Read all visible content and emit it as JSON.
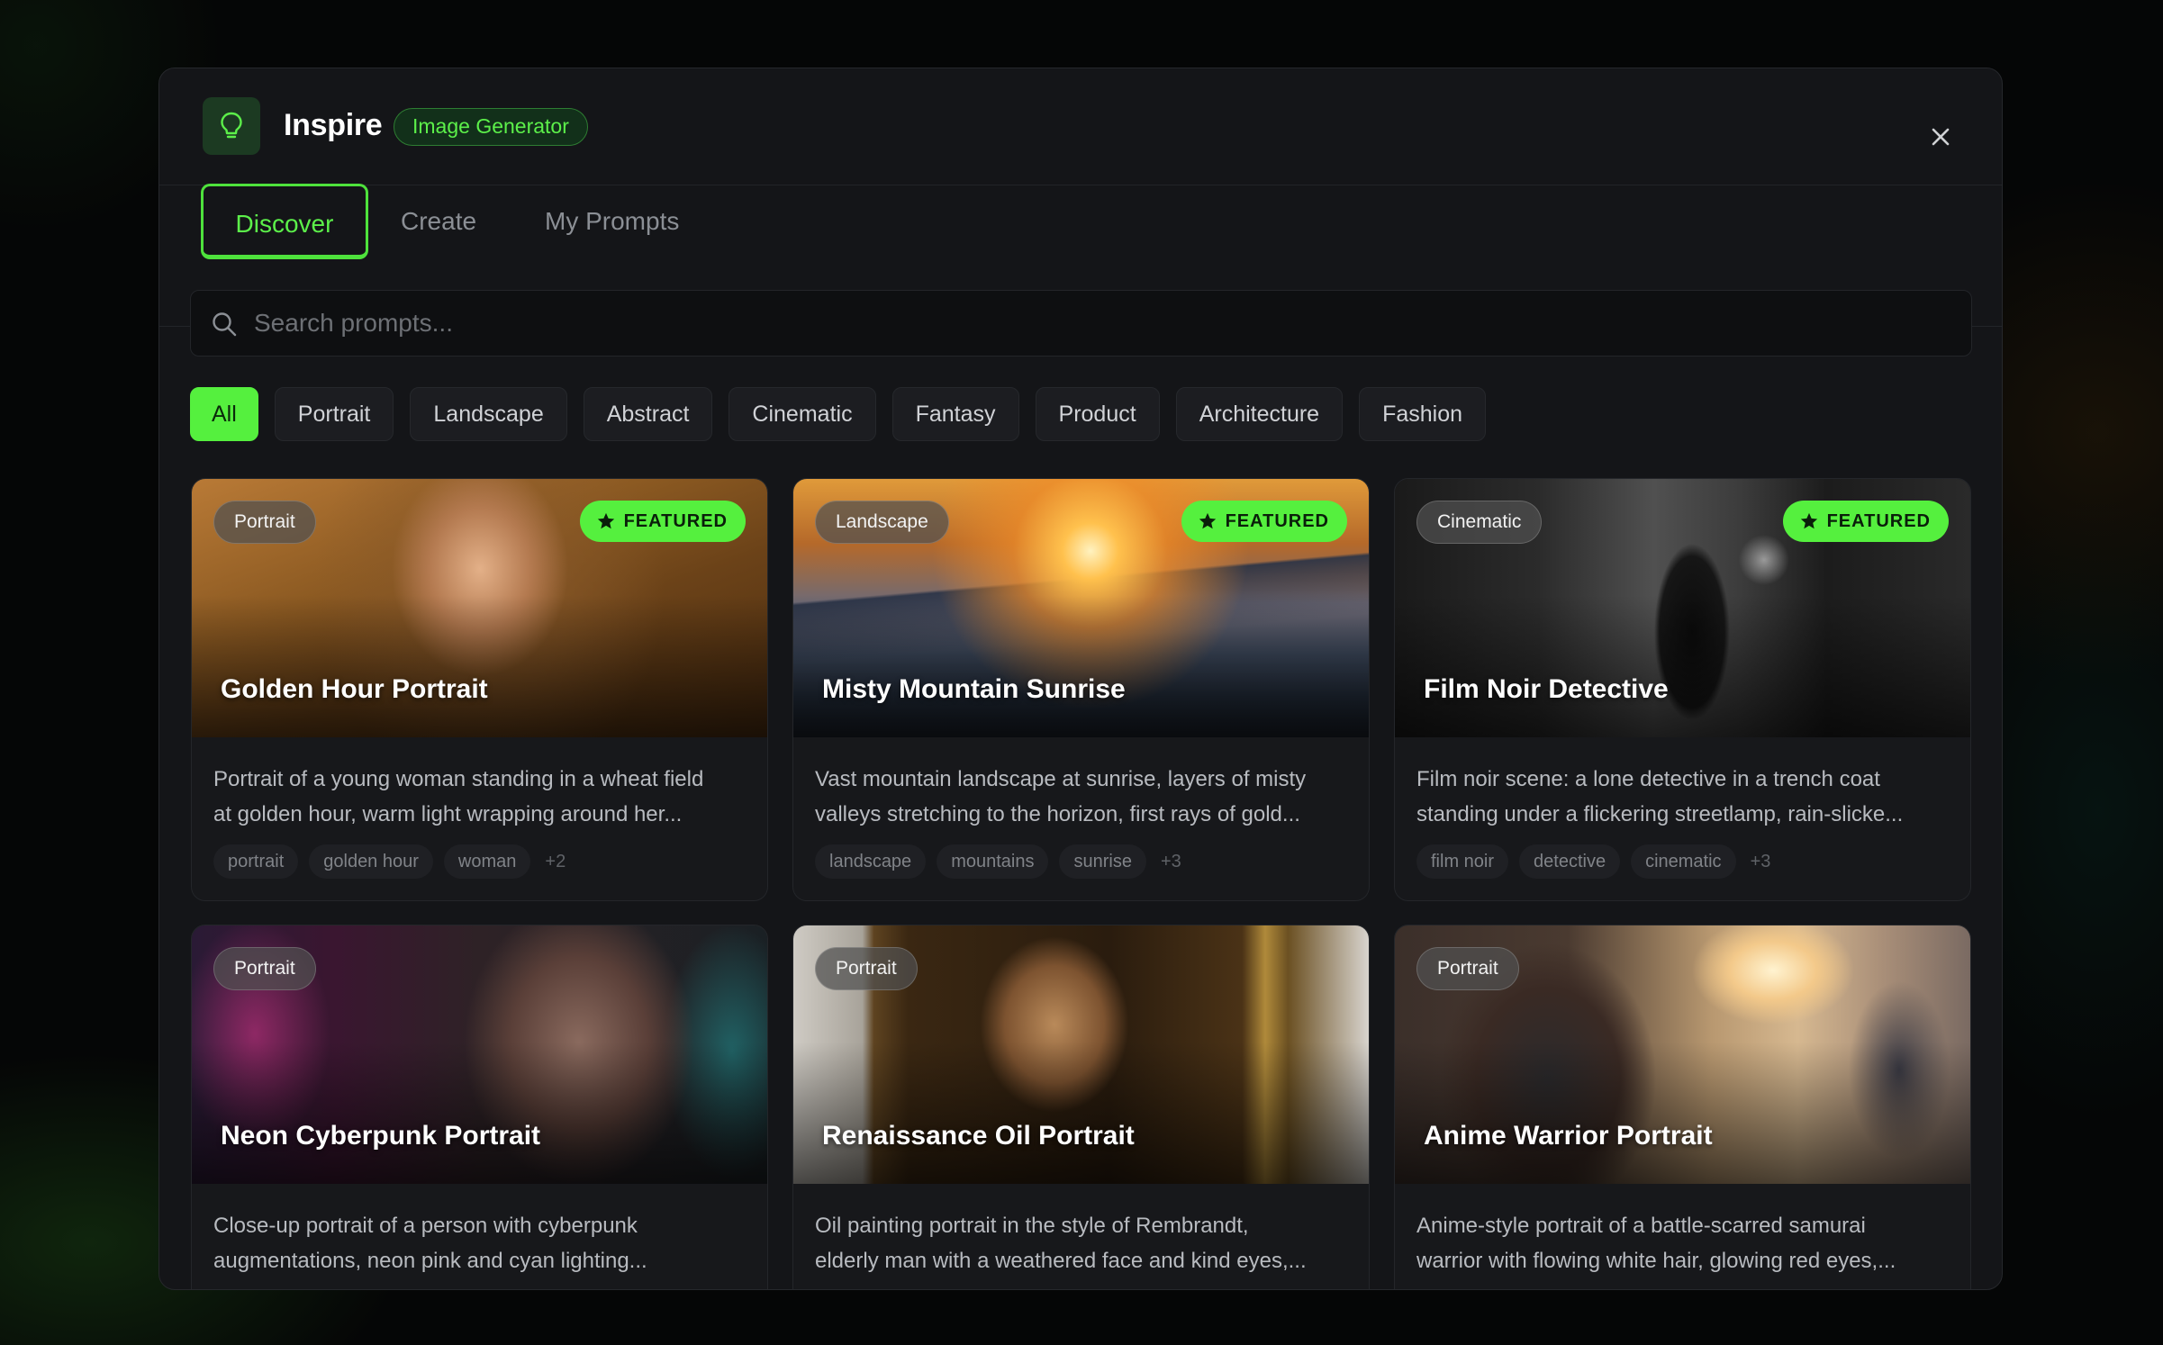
{
  "header": {
    "title": "Inspire",
    "badge": "Image Generator"
  },
  "tabs": [
    {
      "label": "Discover",
      "active": true
    },
    {
      "label": "Create",
      "active": false
    },
    {
      "label": "My Prompts",
      "active": false
    }
  ],
  "search": {
    "placeholder": "Search prompts...",
    "value": ""
  },
  "filters": [
    {
      "label": "All",
      "active": true
    },
    {
      "label": "Portrait",
      "active": false
    },
    {
      "label": "Landscape",
      "active": false
    },
    {
      "label": "Abstract",
      "active": false
    },
    {
      "label": "Cinematic",
      "active": false
    },
    {
      "label": "Fantasy",
      "active": false
    },
    {
      "label": "Product",
      "active": false
    },
    {
      "label": "Architecture",
      "active": false
    },
    {
      "label": "Fashion",
      "active": false
    }
  ],
  "featured_label": "FEATURED",
  "cards": [
    {
      "category": "Portrait",
      "featured": true,
      "title": "Golden Hour Portrait",
      "desc1": "Portrait of a young woman standing in a wheat field",
      "desc2": "at golden hour, warm light wrapping around her...",
      "tags": [
        "portrait",
        "golden hour",
        "woman"
      ],
      "more": "+2"
    },
    {
      "category": "Landscape",
      "featured": true,
      "title": "Misty Mountain Sunrise",
      "desc1": "Vast mountain landscape at sunrise, layers of misty",
      "desc2": "valleys stretching to the horizon, first rays of gold...",
      "tags": [
        "landscape",
        "mountains",
        "sunrise"
      ],
      "more": "+3"
    },
    {
      "category": "Cinematic",
      "featured": true,
      "title": "Film Noir Detective",
      "desc1": "Film noir scene: a lone detective in a trench coat",
      "desc2": "standing under a flickering streetlamp, rain-slicke...",
      "tags": [
        "film noir",
        "detective",
        "cinematic"
      ],
      "more": "+3"
    },
    {
      "category": "Portrait",
      "featured": false,
      "title": "Neon Cyberpunk Portrait",
      "desc1": "Close-up portrait of a person with cyberpunk",
      "desc2": "augmentations, neon pink and cyan lighting..."
    },
    {
      "category": "Portrait",
      "featured": false,
      "title": "Renaissance Oil Portrait",
      "desc1": "Oil painting portrait in the style of Rembrandt,",
      "desc2": "elderly man with a weathered face and kind eyes,..."
    },
    {
      "category": "Portrait",
      "featured": false,
      "title": "Anime Warrior Portrait",
      "desc1": "Anime-style portrait of a battle-scarred samurai",
      "desc2": "warrior with flowing white hair, glowing red eyes,..."
    }
  ],
  "colors": {
    "accent": "#55f03e",
    "background": "#141518"
  }
}
